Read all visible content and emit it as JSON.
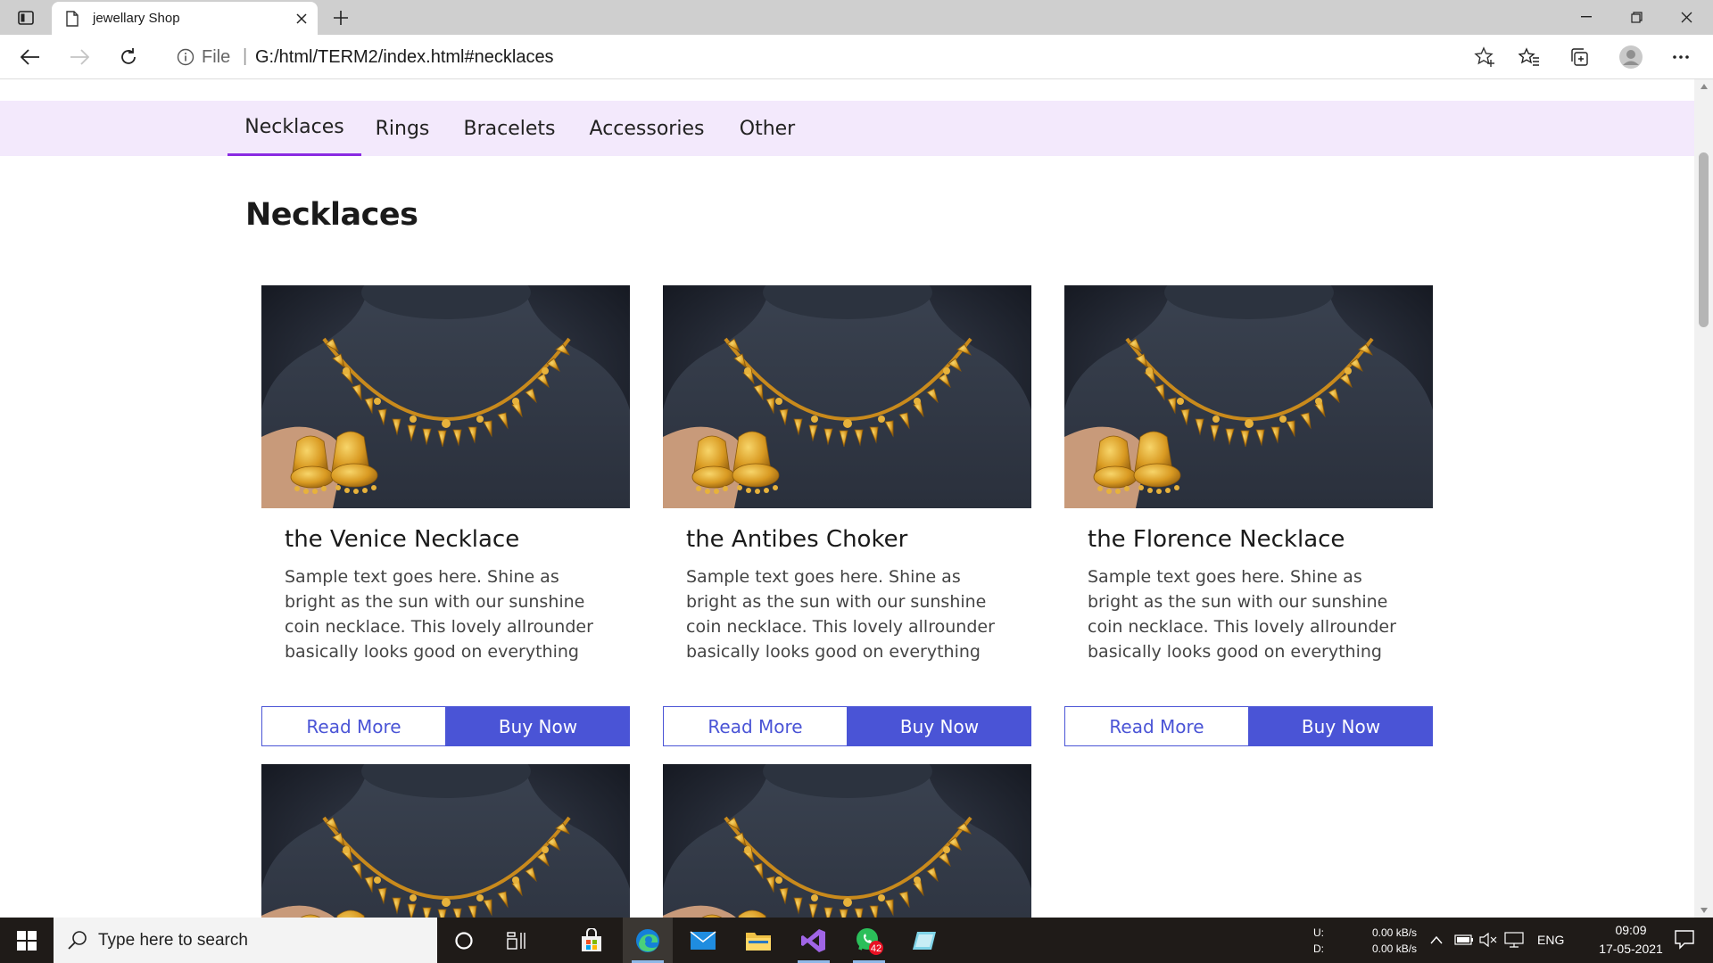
{
  "browser": {
    "tab_title": "jewellary Shop",
    "url_scheme": "File",
    "url_separator": "|",
    "url": "G:/html/TERM2/index.html#necklaces"
  },
  "site": {
    "nav": [
      {
        "label": "Necklaces",
        "active": true
      },
      {
        "label": "Rings",
        "active": false
      },
      {
        "label": "Bracelets",
        "active": false
      },
      {
        "label": "Accessories",
        "active": false
      },
      {
        "label": "Other",
        "active": false
      }
    ],
    "section_heading": "Necklaces",
    "products": [
      {
        "name": "the Venice Necklace",
        "description": "Sample text goes here. Shine as bright as the sun with our sunshine coin necklace. This lovely allrounder basically looks good on everything",
        "read_more": "Read More",
        "buy_now": "Buy Now"
      },
      {
        "name": "the Antibes Choker",
        "description": "Sample text goes here. Shine as bright as the sun with our sunshine coin necklace. This lovely allrounder basically looks good on everything",
        "read_more": "Read More",
        "buy_now": "Buy Now"
      },
      {
        "name": "the Florence Necklace",
        "description": "Sample text goes here. Shine as bright as the sun with our sunshine coin necklace. This lovely allrounder basically looks good on everything",
        "read_more": "Read More",
        "buy_now": "Buy Now"
      }
    ],
    "accent_color": "#4a54d6",
    "nav_background": "#f3e9fc",
    "nav_active_underline": "#8a2be2"
  },
  "taskbar": {
    "search_placeholder": "Type here to search",
    "whatsapp_badge": "42",
    "net_upload_label": "U:",
    "net_download_label": "D:",
    "net_upload_value": "0.00 kB/s",
    "net_download_value": "0.00 kB/s",
    "language": "ENG",
    "time": "09:09",
    "date": "17-05-2021"
  }
}
